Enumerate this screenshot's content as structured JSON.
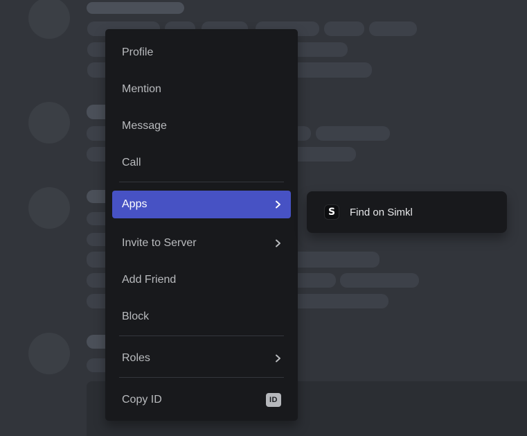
{
  "context_menu": {
    "items": [
      {
        "label": "Profile"
      },
      {
        "label": "Mention"
      },
      {
        "label": "Message"
      },
      {
        "label": "Call"
      },
      {
        "label": "Apps",
        "has_submenu": true,
        "highlighted": true
      },
      {
        "label": "Invite to Server",
        "has_submenu": true
      },
      {
        "label": "Add Friend"
      },
      {
        "label": "Block"
      },
      {
        "label": "Roles",
        "has_submenu": true
      },
      {
        "label": "Copy ID",
        "badge": "ID"
      }
    ]
  },
  "submenu": {
    "items": [
      {
        "label": "Find on Simkl",
        "icon": "simkl-logo",
        "icon_letter": "S"
      }
    ]
  },
  "colors": {
    "background": "#32353b",
    "menu_bg": "#18191c",
    "accent": "#4752c4",
    "item_text": "#b9bbbe",
    "highlight_text": "#ffffff",
    "divider": "#34373d",
    "badge_bg": "#b6b8bc",
    "badge_text": "#1b1d21",
    "skeleton_avatar": "#3b3f45",
    "skeleton_name": "#4b5059",
    "skeleton_line": "#3d4149",
    "skeleton_embed": "#2b2e33"
  }
}
